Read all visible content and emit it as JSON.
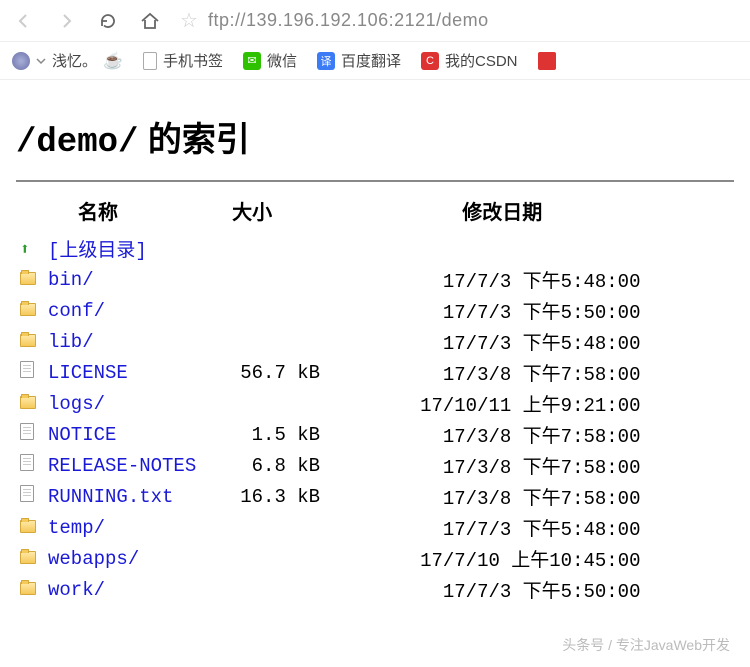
{
  "browser": {
    "url": "ftp://139.196.192.106:2121/demo"
  },
  "bookmarks": {
    "qianyi": "浅忆。",
    "mobile": "手机书签",
    "wechat": "微信",
    "baidu_tr": "百度翻译",
    "baidu_icon": "译",
    "csdn": "我的CSDN",
    "csdn_icon": "C"
  },
  "page": {
    "title_path": "/demo/",
    "title_suffix": " 的索引",
    "col_name": "名称",
    "col_size": "大小",
    "col_date": "修改日期",
    "parent": "[上级目录]",
    "rows": [
      {
        "type": "dir",
        "name": "bin/",
        "size": "",
        "date": "17/7/3 下午5:48:00"
      },
      {
        "type": "dir",
        "name": "conf/",
        "size": "",
        "date": "17/7/3 下午5:50:00"
      },
      {
        "type": "dir",
        "name": "lib/",
        "size": "",
        "date": "17/7/3 下午5:48:00"
      },
      {
        "type": "file",
        "name": "LICENSE",
        "size": "56.7 kB",
        "date": "17/3/8 下午7:58:00"
      },
      {
        "type": "dir",
        "name": "logs/",
        "size": "",
        "date": "17/10/11 上午9:21:00"
      },
      {
        "type": "file",
        "name": "NOTICE",
        "size": "1.5 kB",
        "date": "17/3/8 下午7:58:00"
      },
      {
        "type": "file",
        "name": "RELEASE-NOTES",
        "size": "6.8 kB",
        "date": "17/3/8 下午7:58:00"
      },
      {
        "type": "file",
        "name": "RUNNING.txt",
        "size": "16.3 kB",
        "date": "17/3/8 下午7:58:00"
      },
      {
        "type": "dir",
        "name": "temp/",
        "size": "",
        "date": "17/7/3 下午5:48:00"
      },
      {
        "type": "dir",
        "name": "webapps/",
        "size": "",
        "date": "17/7/10 上午10:45:00"
      },
      {
        "type": "dir",
        "name": "work/",
        "size": "",
        "date": "17/7/3 下午5:50:00"
      }
    ]
  },
  "watermark": "头条号 / 专注JavaWeb开发"
}
